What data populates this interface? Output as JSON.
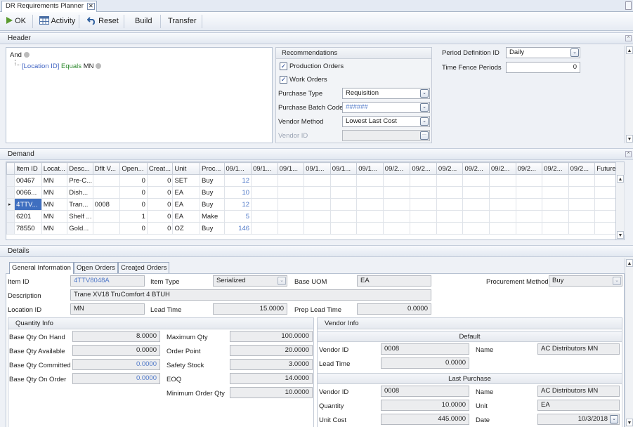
{
  "window": {
    "tab_title": "DR Requirements Planner",
    "close_glyph": "✕"
  },
  "toolbar": {
    "ok": "OK",
    "activity": "Activity",
    "reset": "Reset",
    "build": "Build",
    "transfer": "Transfer"
  },
  "header": {
    "section_title": "Header",
    "filter": {
      "root": "And",
      "condition_field": "[Location ID]",
      "condition_op": "Equals",
      "condition_value": "MN"
    },
    "recommendations": {
      "title": "Recommendations",
      "production_orders": {
        "label": "Production Orders",
        "checked": true
      },
      "work_orders": {
        "label": "Work Orders",
        "checked": true
      },
      "purchase_type": {
        "label": "Purchase Type",
        "value": "Requisition"
      },
      "purchase_batch_code": {
        "label": "Purchase Batch Code",
        "value": "######"
      },
      "vendor_method": {
        "label": "Vendor Method",
        "value": "Lowest Last Cost"
      },
      "vendor_id": {
        "label": "Vendor ID",
        "value": ""
      }
    },
    "period_definition": {
      "label": "Period Definition ID",
      "value": "Daily"
    },
    "time_fence": {
      "label": "Time Fence Periods",
      "value": "0"
    }
  },
  "demand": {
    "section_title": "Demand",
    "columns": [
      "Item ID",
      "Locat...",
      "Desc...",
      "Dflt V...",
      "Open...",
      "Creat...",
      "Unit",
      "Proc...",
      "09/1...",
      "09/1...",
      "09/1...",
      "09/1...",
      "09/1...",
      "09/1...",
      "09/2...",
      "09/2...",
      "09/2...",
      "09/2...",
      "09/2...",
      "09/2...",
      "09/2...",
      "09/2...",
      "Future..."
    ],
    "rows": [
      {
        "item": "00467",
        "loc": "MN",
        "desc": "Pre-C...",
        "dflt": "",
        "open": "0",
        "created": "0",
        "unit": "SET",
        "proc": "Buy",
        "p1": "12"
      },
      {
        "item": "0066...",
        "loc": "MN",
        "desc": "Dish...",
        "dflt": "",
        "open": "0",
        "created": "0",
        "unit": "EA",
        "proc": "Buy",
        "p1": "10"
      },
      {
        "item": "4TTV...",
        "loc": "MN",
        "desc": "Tran...",
        "dflt": "0008",
        "open": "0",
        "created": "0",
        "unit": "EA",
        "proc": "Buy",
        "p1": "12"
      },
      {
        "item": "6201",
        "loc": "MN",
        "desc": "Shelf ...",
        "dflt": "",
        "open": "1",
        "created": "0",
        "unit": "EA",
        "proc": "Make",
        "p1": "5"
      },
      {
        "item": "78550",
        "loc": "MN",
        "desc": "Gold...",
        "dflt": "",
        "open": "0",
        "created": "0",
        "unit": "OZ",
        "proc": "Buy",
        "p1": "146"
      }
    ],
    "selected_row": 2,
    "row_indicator": "▸"
  },
  "details": {
    "section_title": "Details",
    "tabs": [
      "General Information",
      "Open Orders",
      "Created Orders"
    ],
    "item_id": {
      "label": "Item ID",
      "value": "4TTV8048A"
    },
    "item_type": {
      "label": "Item Type",
      "value": "Serialized"
    },
    "base_uom": {
      "label": "Base UOM",
      "value": "EA"
    },
    "procurement_method": {
      "label": "Procurement Method",
      "value": "Buy"
    },
    "description": {
      "label": "Description",
      "value": "Trane XV18 TruComfort 4 BTUH"
    },
    "location_id": {
      "label": "Location ID",
      "value": "MN"
    },
    "lead_time": {
      "label": "Lead Time",
      "value": "15.0000"
    },
    "prep_lead_time": {
      "label": "Prep Lead Time",
      "value": "0.0000"
    },
    "quantity_info": {
      "title": "Quantity Info",
      "on_hand": {
        "label": "Base Qty On Hand",
        "value": "8.0000"
      },
      "available": {
        "label": "Base Qty Available",
        "value": "0.0000"
      },
      "committed": {
        "label": "Base Qty Committed",
        "value": "0.0000"
      },
      "on_order": {
        "label": "Base Qty On Order",
        "value": "0.0000"
      },
      "maximum": {
        "label": "Maximum Qty",
        "value": "100.0000"
      },
      "order_point": {
        "label": "Order Point",
        "value": "20.0000"
      },
      "safety_stock": {
        "label": "Safety Stock",
        "value": "3.0000"
      },
      "eoq": {
        "label": "EOQ",
        "value": "14.0000"
      },
      "min_order": {
        "label": "Minimum Order Qty",
        "value": "10.0000"
      }
    },
    "vendor_info": {
      "title": "Vendor Info",
      "default_title": "Default",
      "vendor_id": {
        "label": "Vendor ID",
        "value": "0008"
      },
      "name": {
        "label": "Name",
        "value": "AC Distributors MN"
      },
      "lead_time": {
        "label": "Lead Time",
        "value": "0.0000"
      },
      "last_purchase_title": "Last Purchase",
      "lp_vendor_id": {
        "label": "Vendor ID",
        "value": "0008"
      },
      "lp_name": {
        "label": "Name",
        "value": "AC Distributors MN"
      },
      "quantity": {
        "label": "Quantity",
        "value": "10.0000"
      },
      "unit": {
        "label": "Unit",
        "value": "EA"
      },
      "unit_cost": {
        "label": "Unit Cost",
        "value": "445.0000"
      },
      "date": {
        "label": "Date",
        "value": "10/3/2018"
      }
    }
  },
  "icons": {
    "check": "✓",
    "dropdown": "⌄",
    "ellipsis": "···",
    "up": "▲",
    "down": "▼",
    "collapse": "⌃"
  }
}
